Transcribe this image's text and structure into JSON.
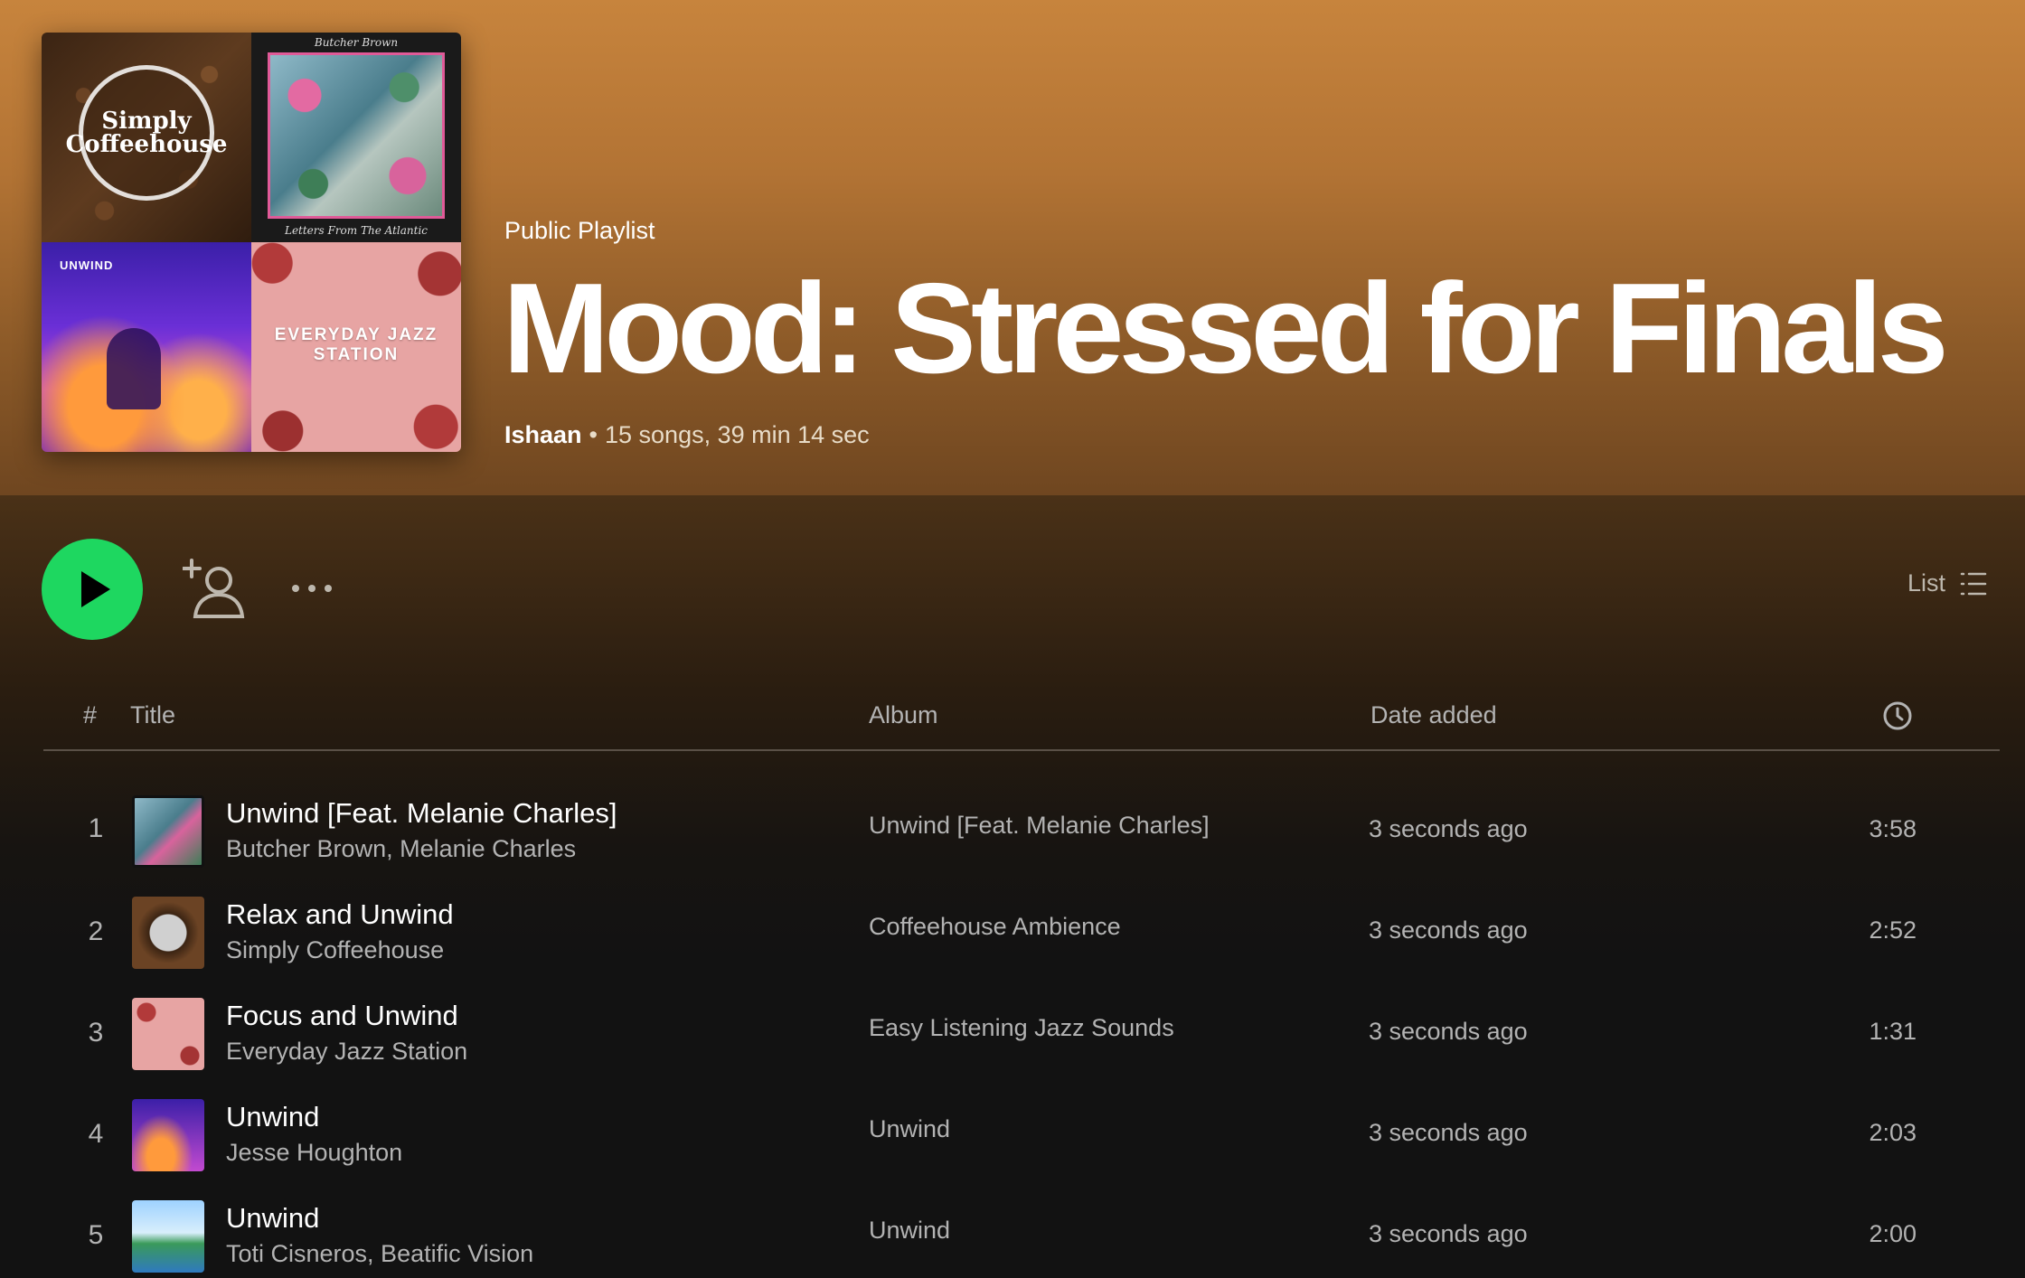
{
  "cover": {
    "tile1_text": "Simply Coffeehouse",
    "tile2_top": "Butcher Brown",
    "tile2_bottom": "Letters From The Atlantic",
    "tile3_text": "UNWIND",
    "tile4_text": "EVERYDAY JAZZ STATION"
  },
  "playlist": {
    "type": "Public Playlist",
    "title": "Mood: Stressed for Finals",
    "owner": "Ishaan",
    "separator": "•",
    "summary": "15 songs, 39 min 14 sec"
  },
  "actions": {
    "list_label": "List"
  },
  "table": {
    "headers": {
      "number": "#",
      "title": "Title",
      "album": "Album",
      "date_added": "Date added"
    },
    "rows": [
      {
        "num": "1",
        "title": "Unwind [Feat. Melanie Charles]",
        "artist": "Butcher Brown, Melanie Charles",
        "album": "Unwind [Feat. Melanie Charles]",
        "date_added": "3 seconds ago",
        "duration": "3:58"
      },
      {
        "num": "2",
        "title": "Relax and Unwind",
        "artist": "Simply Coffeehouse",
        "album": "Coffeehouse Ambience",
        "date_added": "3 seconds ago",
        "duration": "2:52"
      },
      {
        "num": "3",
        "title": "Focus and Unwind",
        "artist": "Everyday Jazz Station",
        "album": "Easy Listening Jazz Sounds",
        "date_added": "3 seconds ago",
        "duration": "1:31"
      },
      {
        "num": "4",
        "title": "Unwind",
        "artist": "Jesse Houghton",
        "album": "Unwind",
        "date_added": "3 seconds ago",
        "duration": "2:03"
      },
      {
        "num": "5",
        "title": "Unwind",
        "artist": "Toti Cisneros, Beatific Vision",
        "album": "Unwind",
        "date_added": "3 seconds ago",
        "duration": "2:00"
      }
    ]
  },
  "icons": {
    "play": "play-icon",
    "follow": "add-user-icon",
    "more": "more-options-icon",
    "list": "list-icon",
    "clock": "clock-icon"
  },
  "colors": {
    "accent_green": "#1ed760",
    "header_brown": "#b27334",
    "background": "#121212"
  }
}
